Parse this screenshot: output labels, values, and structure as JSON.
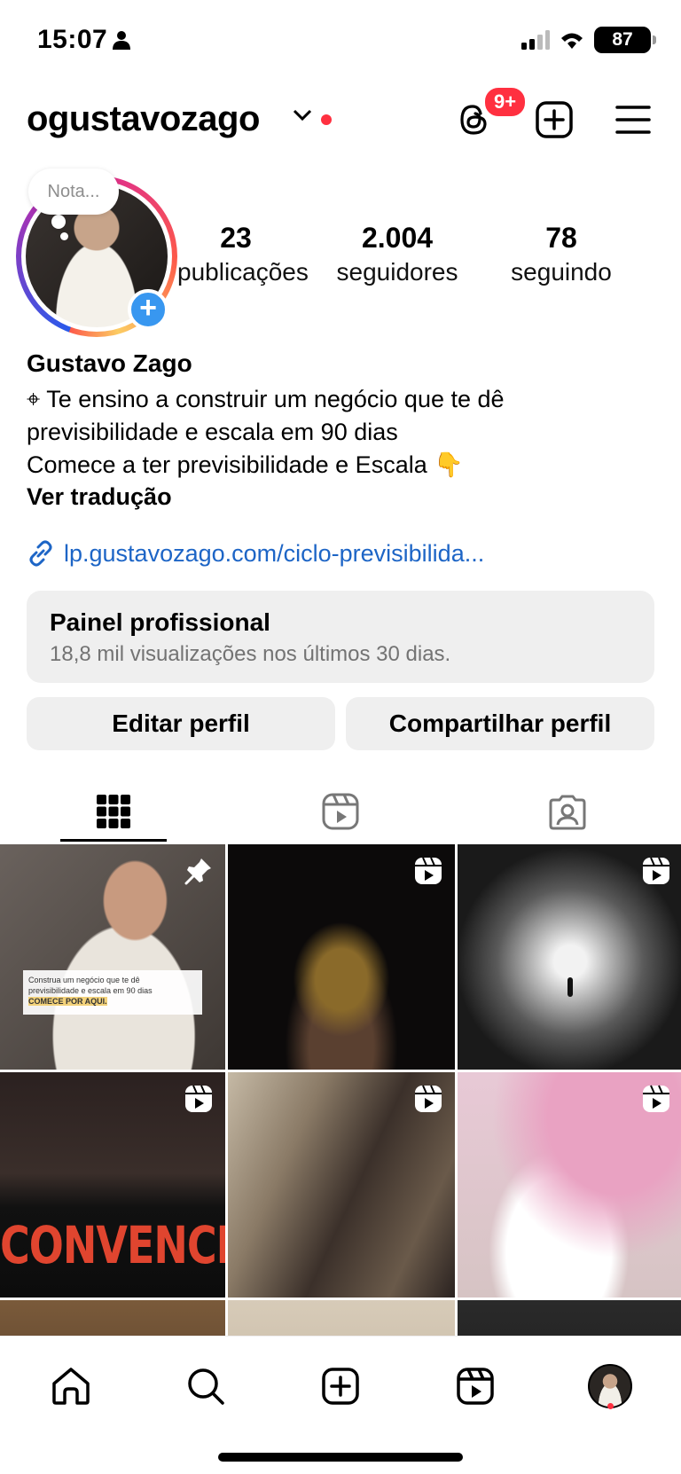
{
  "status_bar": {
    "time": "15:07",
    "battery": "87"
  },
  "header": {
    "username": "ogustavozago",
    "threads_badge": "9+"
  },
  "profile": {
    "note_placeholder": "Nota...",
    "stats": [
      {
        "value": "23",
        "label": "publicações"
      },
      {
        "value": "2.004",
        "label": "seguidores"
      },
      {
        "value": "78",
        "label": "seguindo"
      }
    ],
    "name": "Gustavo Zago",
    "bio_line1": "⌖ Te ensino a construir um negócio que te dê",
    "bio_line2": "previsibilidade e escala em 90 dias",
    "bio_line3": "Comece a ter previsibilidade e Escala 👇",
    "see_translation": "Ver tradução",
    "link": "lp.gustavozago.com/ciclo-previsibilida..."
  },
  "pro_panel": {
    "title": "Painel profissional",
    "subtitle": "18,8 mil visualizações nos últimos 30 dias."
  },
  "buttons": {
    "edit": "Editar perfil",
    "share": "Compartilhar perfil"
  },
  "posts": {
    "post1_card_line1": "Construa um negócio que te dê",
    "post1_card_line2": "previsibilidade e escala em 90 dias",
    "post1_card_cta": "COMECE POR AQUI.",
    "post4_word": "CONVENCER"
  },
  "colors": {
    "accent_blue": "#3897f0",
    "link_blue": "#1d65c6",
    "notification_red": "#ff3040"
  },
  "icons": [
    "person-icon",
    "signal-icon",
    "wifi-icon",
    "chevron-down-icon",
    "threads-icon",
    "plus-square-icon",
    "menu-icon",
    "grid-icon",
    "reels-icon",
    "tagged-icon",
    "pin-icon",
    "home-icon",
    "search-icon",
    "link-icon"
  ]
}
